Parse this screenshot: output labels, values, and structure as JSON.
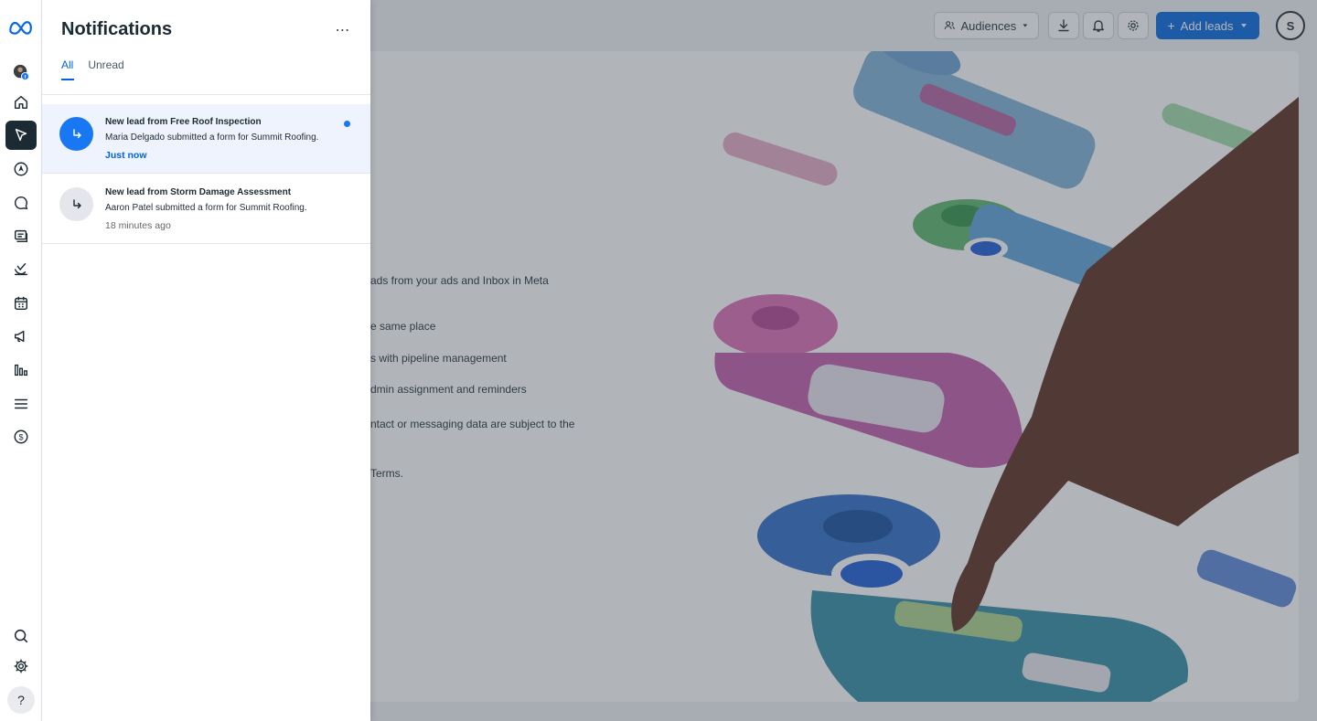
{
  "panel": {
    "title": "Notifications",
    "more_icon": "more-horizontal-icon",
    "tabs": [
      {
        "label": "All",
        "active": true
      },
      {
        "label": "Unread",
        "active": false
      }
    ]
  },
  "notifications": [
    {
      "title": "New lead from Free Roof Inspection",
      "body": "Maria Delgado submitted a form for Summit Roofing.",
      "time": "Just now",
      "unread": true,
      "icon": "lead-arrow-icon"
    },
    {
      "title": "New lead from Storm Damage Assessment",
      "body": "Aaron Patel submitted a form for Summit Roofing.",
      "time": "18 minutes ago",
      "unread": false,
      "icon": "lead-arrow-icon"
    }
  ],
  "rail": {
    "items": [
      "meta-logo-icon",
      "profile-avatar-icon",
      "home-icon",
      "leads-icon",
      "compass-icon",
      "chat-icon",
      "content-icon",
      "planner-icon",
      "calendar-icon",
      "ads-megaphone-icon",
      "insights-icon",
      "menu-icon",
      "billing-icon",
      "search-icon",
      "settings-icon",
      "help-icon"
    ],
    "help_label": "?"
  },
  "topbar": {
    "audiences_label": "Audiences",
    "add_leads_label": "Add leads",
    "avatar_initial": "S"
  },
  "promo": {
    "line1": "ads from your ads and Inbox in Meta",
    "line2": "e same place",
    "line3": "s with pipeline management",
    "line4": "dmin assignment and reminders",
    "line5": "ntact or messaging data are subject to the",
    "line6": "Terms."
  },
  "colors": {
    "accent": "#0064e0",
    "unread_bg": "#eef3fd",
    "unread_dot": "#1877f2",
    "active_rail_bg": "#1c2b33"
  }
}
